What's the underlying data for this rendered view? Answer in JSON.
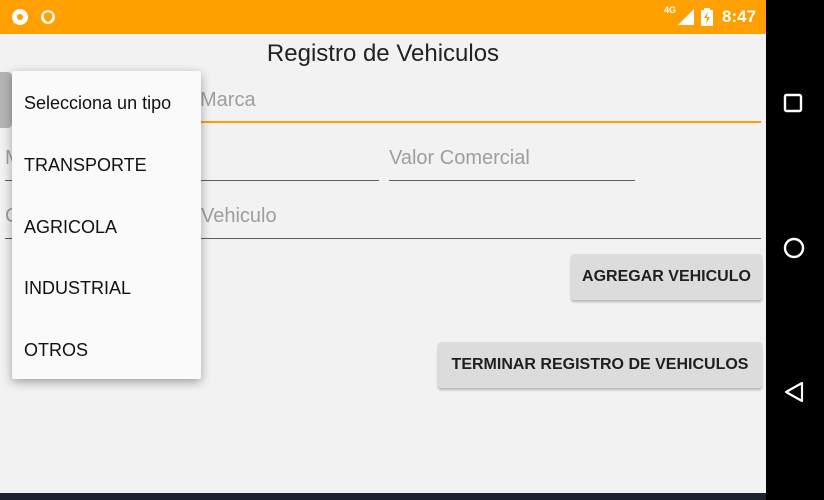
{
  "status_bar": {
    "time": "8:47",
    "network": "4G",
    "icons": [
      "chat-icon",
      "shield-icon",
      "signal-icon",
      "battery-icon"
    ],
    "color": "#ff9f00"
  },
  "header": {
    "title": "Registro de Vehiculos"
  },
  "form": {
    "marca_placeholder": "Marca",
    "modelo_placeholder": "M",
    "valor_placeholder": "Valor Comercial",
    "color_placeholder": "C",
    "vehiculo_placeholder": "Vehiculo"
  },
  "buttons": {
    "add_label": "AGREGAR VEHICULO",
    "finish_label": "TERMINAR REGISTRO DE VEHICULOS"
  },
  "dropdown": {
    "items": [
      {
        "label": "Selecciona un tipo"
      },
      {
        "label": "TRANSPORTE"
      },
      {
        "label": "AGRICOLA"
      },
      {
        "label": "INDUSTRIAL"
      },
      {
        "label": "OTROS"
      }
    ]
  },
  "nav": {
    "icons": [
      "recents-square-icon",
      "home-circle-icon",
      "back-triangle-icon"
    ]
  },
  "colors": {
    "accent": "#ff9f00",
    "background": "#f2f2f2",
    "button": "#dcdcdc"
  }
}
